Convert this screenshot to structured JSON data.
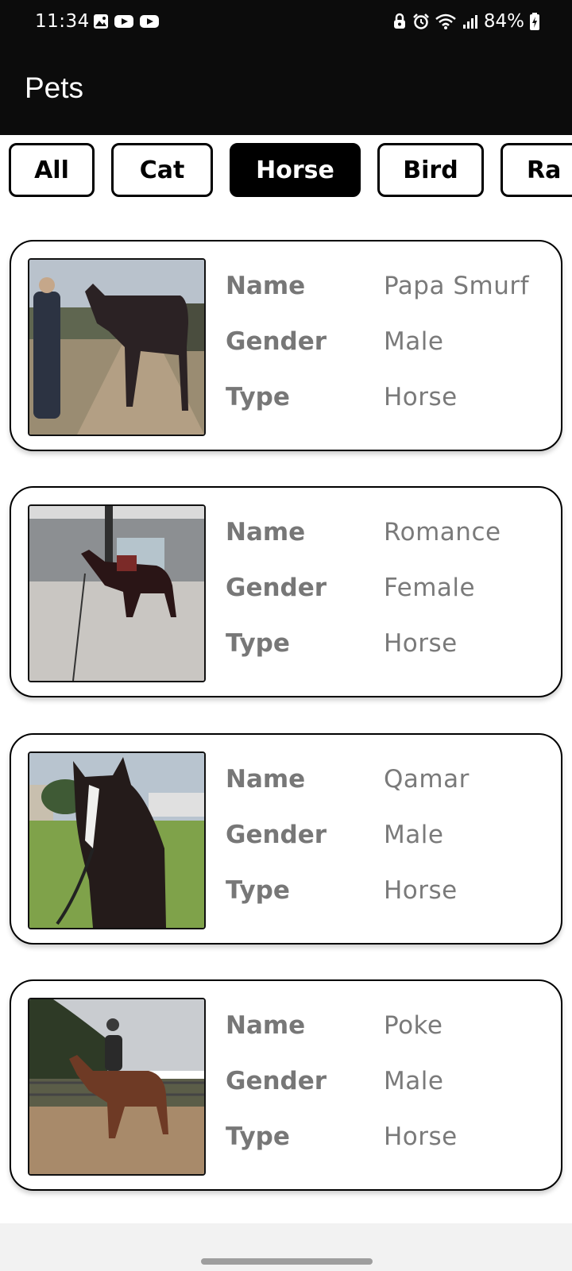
{
  "status_bar": {
    "time": "11:34",
    "left_icons": [
      "gallery-icon",
      "youtube-icon",
      "youtube-icon"
    ],
    "right_icons": [
      "lock-icon",
      "alarm-icon",
      "wifi-icon",
      "signal-icon",
      "battery-icon"
    ],
    "battery": "84%"
  },
  "app_bar": {
    "title": "Pets"
  },
  "filters": {
    "chips": [
      {
        "label": "All"
      },
      {
        "label": "Cat"
      },
      {
        "label": "Horse"
      },
      {
        "label": "Bird"
      },
      {
        "label": "Ra"
      }
    ],
    "selected": "Horse"
  },
  "pets": [
    {
      "name_label": "Name",
      "name": "Papa Smurf",
      "gender_label": "Gender",
      "gender": "Male",
      "type_label": "Type",
      "type": "Horse"
    },
    {
      "name_label": "Name",
      "name": "Romance",
      "gender_label": "Gender",
      "gender": "Female",
      "type_label": "Type",
      "type": "Horse"
    },
    {
      "name_label": "Name",
      "name": "Qamar",
      "gender_label": "Gender",
      "gender": "Male",
      "type_label": "Type",
      "type": "Horse"
    },
    {
      "name_label": "Name",
      "name": "Poke",
      "gender_label": "Gender",
      "gender": "Male",
      "type_label": "Type",
      "type": "Horse"
    }
  ],
  "colors": {
    "header_bg": "#0c0c0c",
    "accent": "#000000",
    "label_text": "#777777",
    "value_text": "#7a7a7a"
  }
}
